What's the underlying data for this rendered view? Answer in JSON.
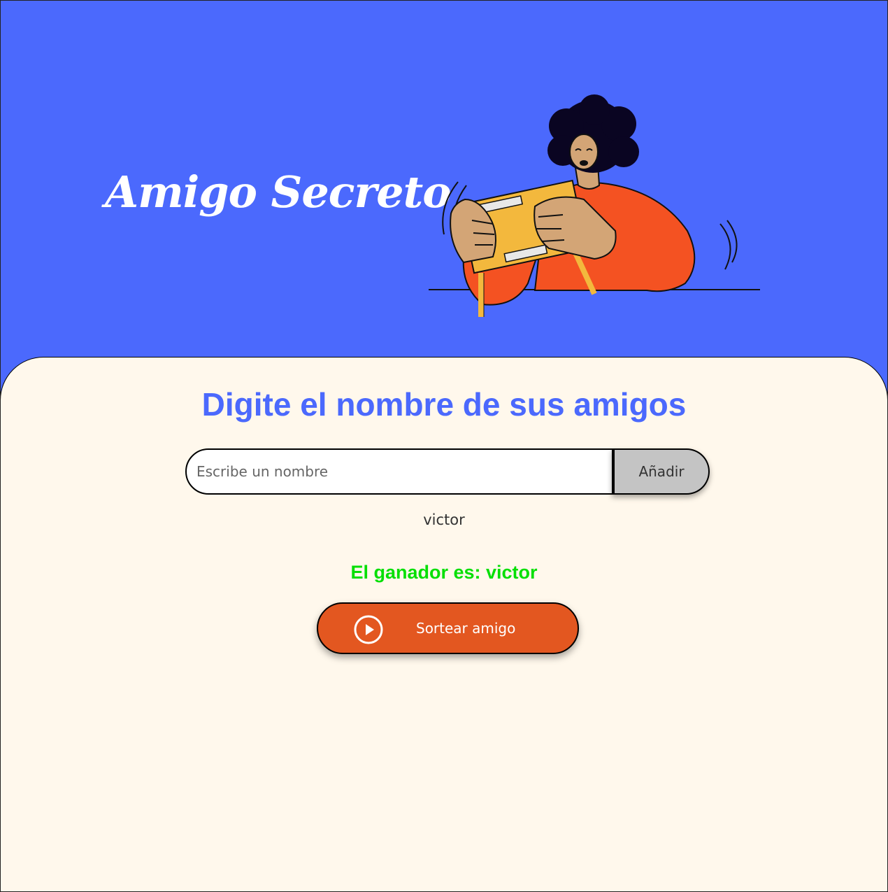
{
  "header": {
    "title": "Amigo Secreto",
    "illustration_icon": "person-shaking-gift-box-illustration"
  },
  "main": {
    "section_title": "Digite el nombre de sus amigos",
    "input": {
      "placeholder": "Escribe un nombre",
      "value": ""
    },
    "add_button_label": "Añadir",
    "friends": [
      "victor"
    ],
    "result_text": "El ganador es: victor",
    "draw_button": {
      "label": "Sortear amigo",
      "icon": "play-circle-icon"
    }
  },
  "colors": {
    "header_bg": "#4B69FD",
    "main_bg": "#FFF8EC",
    "title_accent": "#4B69FD",
    "result_green": "#05DF05",
    "draw_button_bg": "#E35720",
    "add_button_bg": "#C4C4C4"
  }
}
